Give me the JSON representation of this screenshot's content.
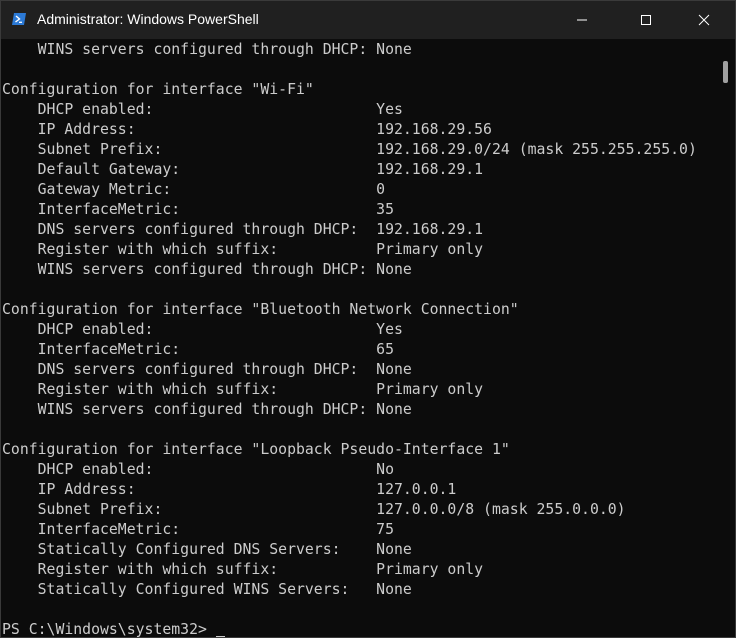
{
  "window": {
    "title": "Administrator: Windows PowerShell",
    "icon": "powershell-icon",
    "controls": [
      "minimize-icon",
      "maximize-icon",
      "close-icon"
    ]
  },
  "terminal": {
    "lines": [
      "    WINS servers configured through DHCP: None",
      "",
      "Configuration for interface \"Wi-Fi\"",
      "    DHCP enabled:                         Yes",
      "    IP Address:                           192.168.29.56",
      "    Subnet Prefix:                        192.168.29.0/24 (mask 255.255.255.0)",
      "    Default Gateway:                      192.168.29.1",
      "    Gateway Metric:                       0",
      "    InterfaceMetric:                      35",
      "    DNS servers configured through DHCP:  192.168.29.1",
      "    Register with which suffix:           Primary only",
      "    WINS servers configured through DHCP: None",
      "",
      "Configuration for interface \"Bluetooth Network Connection\"",
      "    DHCP enabled:                         Yes",
      "    InterfaceMetric:                      65",
      "    DNS servers configured through DHCP:  None",
      "    Register with which suffix:           Primary only",
      "    WINS servers configured through DHCP: None",
      "",
      "Configuration for interface \"Loopback Pseudo-Interface 1\"",
      "    DHCP enabled:                         No",
      "    IP Address:                           127.0.0.1",
      "    Subnet Prefix:                        127.0.0.0/8 (mask 255.0.0.0)",
      "    InterfaceMetric:                      75",
      "    Statically Configured DNS Servers:    None",
      "    Register with which suffix:           Primary only",
      "    Statically Configured WINS Servers:   None",
      "",
      "PS C:\\Windows\\system32> "
    ]
  },
  "colors": {
    "background": "#0c0c0c",
    "titlebar": "#202020",
    "text": "#cccccc",
    "title_text": "#ffffff"
  }
}
